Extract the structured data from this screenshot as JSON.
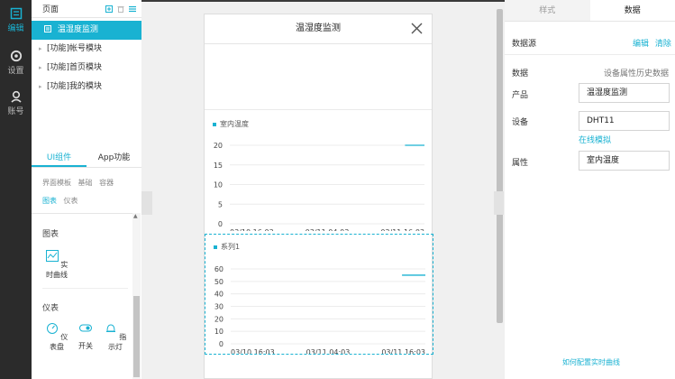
{
  "rail": [
    {
      "label": "编辑",
      "icon": "edit-icon",
      "active": true
    },
    {
      "label": "设置",
      "icon": "settings-icon",
      "active": false
    },
    {
      "label": "账号",
      "icon": "account-icon",
      "active": false
    }
  ],
  "pages": {
    "title": "页面",
    "items": [
      {
        "label": "温湿度监测",
        "active": true
      },
      {
        "label": "[功能]帐号模块",
        "active": false
      },
      {
        "label": "[功能]首页模块",
        "active": false
      },
      {
        "label": "[功能]我的模块",
        "active": false
      }
    ]
  },
  "left_tabs": {
    "ui": "UI组件",
    "app": "App功能"
  },
  "component_categories": {
    "templates": "界面模板",
    "basic": "基础",
    "container": "容器",
    "charts": "图表",
    "instruments": "仪表"
  },
  "sections": {
    "charts_title": "图表",
    "realtime": "实时曲线",
    "instruments_title": "仪表",
    "dashboard": "仪表盘",
    "switch": "开关",
    "indicator": "指示灯"
  },
  "canvas": {
    "title": "温湿度监测"
  },
  "chart_data": [
    {
      "type": "line",
      "title": "室内温度",
      "x": [
        "03/10 16:03",
        "03/11 04:03",
        "03/11 16:03"
      ],
      "yticks": [
        0,
        5,
        10,
        15,
        20
      ],
      "ylim": [
        0,
        20
      ],
      "series": [
        {
          "points": [
            [
              0.9,
              20
            ],
            [
              1.0,
              20
            ]
          ]
        }
      ]
    },
    {
      "type": "line",
      "title": "系列1",
      "x": [
        "03/10 16:03",
        "03/11 04:03",
        "03/11 16:03"
      ],
      "yticks": [
        0,
        10,
        20,
        30,
        40,
        50,
        60
      ],
      "ylim": [
        0,
        60
      ],
      "series": [
        {
          "points": [
            [
              0.88,
              55
            ],
            [
              1.0,
              55
            ]
          ]
        }
      ]
    }
  ],
  "right": {
    "tabs": {
      "style": "样式",
      "data": "数据"
    },
    "datasource": "数据源",
    "edit": "编辑",
    "clear": "清除",
    "data_label": "数据",
    "data_value": "设备属性历史数据",
    "product_label": "产品",
    "product_value": "温湿度监测",
    "device_label": "设备",
    "device_value": "DHT11",
    "simulate": "在线模拟",
    "attr_label": "属性",
    "attr_value": "室内温度",
    "help": "如何配置实时曲线"
  },
  "colors": {
    "accent": "#19b2d2",
    "rail": "#2b2b2b"
  }
}
